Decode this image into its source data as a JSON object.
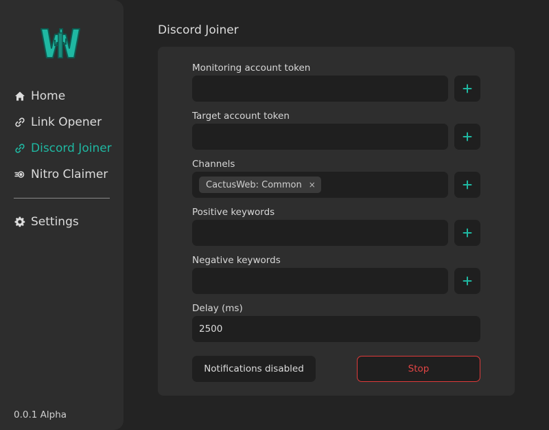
{
  "sidebar": {
    "logo_icon": "cactus-w-logo",
    "items": [
      {
        "label": "Home",
        "icon": "home-icon"
      },
      {
        "label": "Link Opener",
        "icon": "link-icon"
      },
      {
        "label": "Discord Joiner",
        "icon": "link-icon",
        "active": true
      },
      {
        "label": "Nitro Claimer",
        "icon": "nitro-icon"
      }
    ],
    "settings": {
      "label": "Settings",
      "icon": "gear-icon"
    },
    "version": "0.0.1 Alpha"
  },
  "colors": {
    "accent": "#1fb8a2",
    "danger": "#e03a3a",
    "background": "#232323",
    "sidebar": "#2d2d2d",
    "card": "#2e2e2e",
    "input": "#1f1f1f"
  },
  "main": {
    "title": "Discord Joiner",
    "fields": {
      "monitoring_token": {
        "label": "Monitoring account token",
        "value": ""
      },
      "target_token": {
        "label": "Target account token",
        "value": ""
      },
      "channels": {
        "label": "Channels",
        "chips": [
          "CactusWeb: Common"
        ],
        "chip_close": "×"
      },
      "positive_keywords": {
        "label": "Positive keywords",
        "value": ""
      },
      "negative_keywords": {
        "label": "Negative keywords",
        "value": ""
      },
      "delay": {
        "label": "Delay (ms)",
        "value": "2500"
      }
    },
    "notifications_button": "Notifications disabled",
    "stop_button": "Stop"
  }
}
